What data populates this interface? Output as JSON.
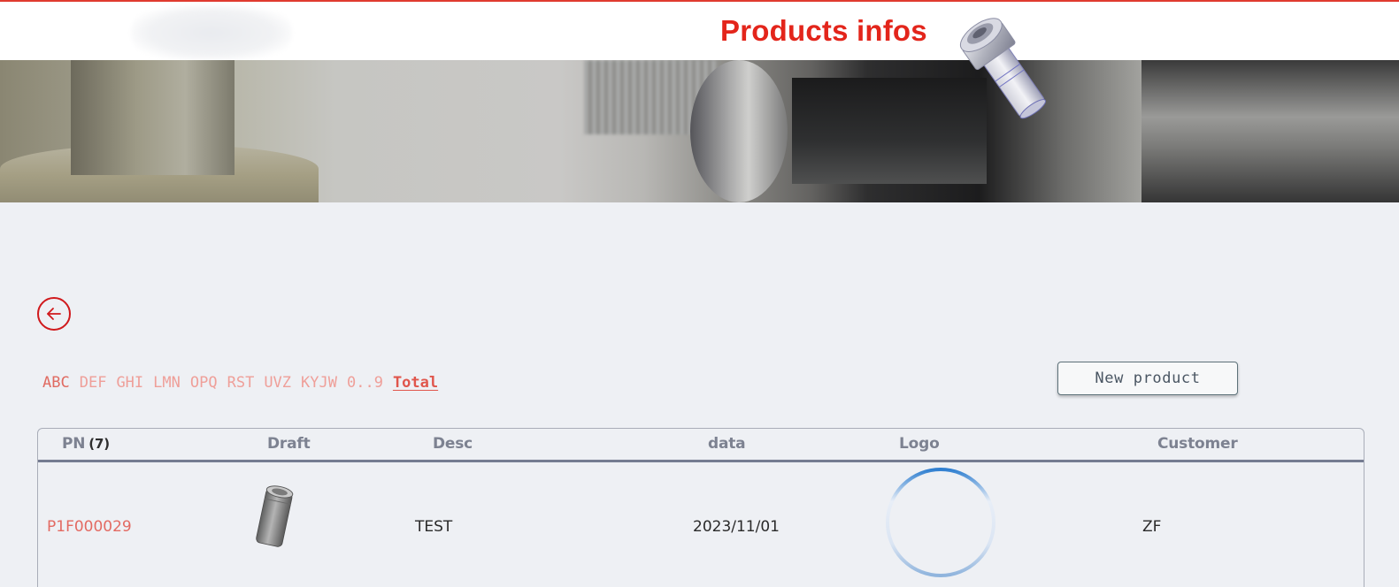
{
  "header": {
    "title": "Products infos"
  },
  "navigation": {
    "back_label": "",
    "alpha_filters": [
      "ABC",
      "DEF",
      "GHI",
      "LMN",
      "OPQ",
      "RST",
      "UVZ",
      "KYJW",
      "0..9",
      "Total"
    ],
    "active_filter": "Total"
  },
  "actions": {
    "new_product_label": "New product"
  },
  "table": {
    "columns": {
      "pn": "PN",
      "pn_count": "(7)",
      "draft": "Draft",
      "desc": "Desc",
      "data": "data",
      "logo": "Logo",
      "customer": "Customer"
    },
    "rows": [
      {
        "pn": "P1F000029",
        "desc": "TEST",
        "data": "2023/11/01",
        "customer": "ZF"
      }
    ]
  },
  "colors": {
    "brand_red": "#e3251b",
    "link_red": "#e36a62",
    "spinner_blue": "#2f7fd0"
  }
}
